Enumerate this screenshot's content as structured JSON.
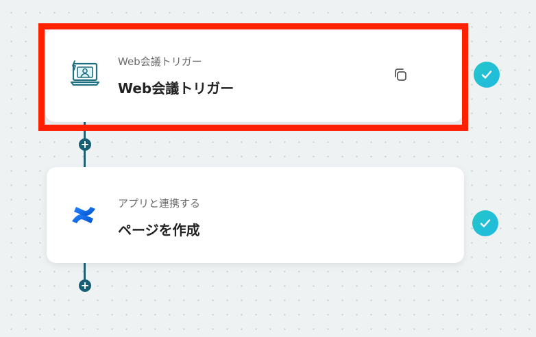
{
  "flow": {
    "steps": [
      {
        "subtitle": "Web会議トリガー",
        "title": "Web会議トリガー",
        "icon": "web-meeting-icon",
        "has_copy": true,
        "selected": true,
        "status": "completed"
      },
      {
        "subtitle": "アプリと連携する",
        "title": "ページを作成",
        "icon": "confluence-icon",
        "has_copy": false,
        "selected": false,
        "status": "completed"
      }
    ]
  },
  "colors": {
    "highlight": "#ff2000",
    "connector": "#155e74",
    "check_start": "#25c6c9",
    "check_end": "#1fb9e0",
    "canvas": "#eef2f3"
  }
}
